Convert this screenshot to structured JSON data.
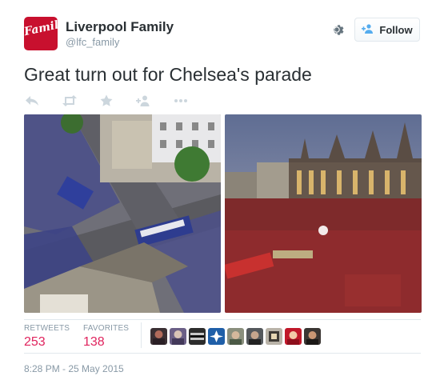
{
  "tweet": {
    "account": {
      "display_name": "Liverpool Family",
      "handle": "@lfc_family",
      "avatar_text": "Family"
    },
    "follow_label": "Follow",
    "text": "Great turn out for Chelsea's parade",
    "stats": {
      "retweets_label": "RETWEETS",
      "retweets_count": "253",
      "favorites_label": "FAVORITES",
      "favorites_count": "138"
    },
    "timestamp": "8:28 PM - 25 May 2015"
  },
  "icons": [
    "reply-icon",
    "retweet-icon",
    "favorite-icon",
    "follow-plus-icon",
    "more-icon",
    "gear-icon"
  ],
  "colors": {
    "brand_red": "#c8102e",
    "stat_count": "#e0245e",
    "meta_gray": "#8899a6",
    "text": "#292f33",
    "follow_icon": "#55acee"
  }
}
